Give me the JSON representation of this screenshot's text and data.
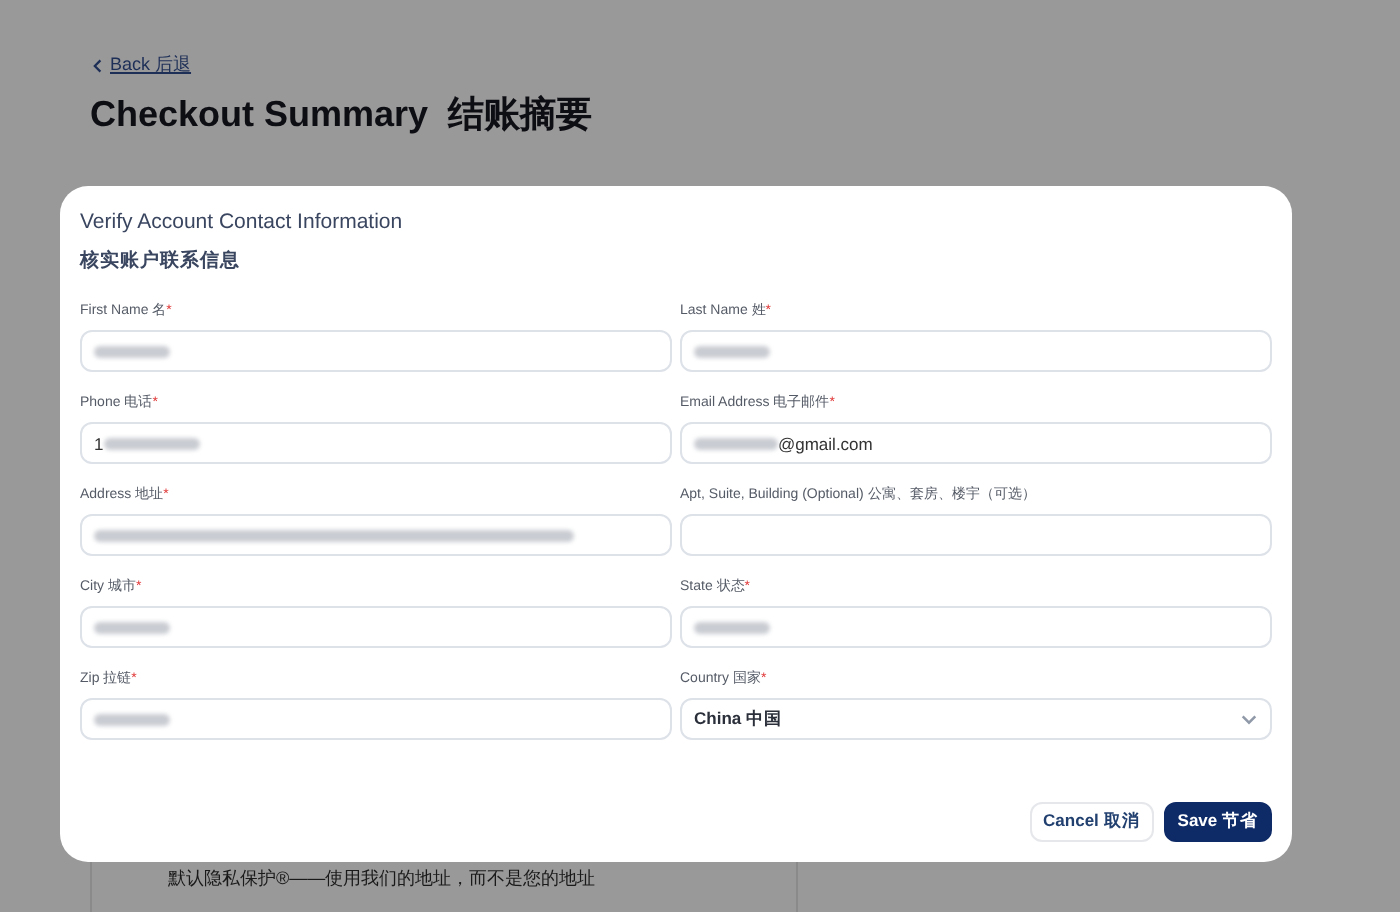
{
  "page": {
    "back_link": "Back 后退",
    "title": "Checkout Summary  结账摘要",
    "notice": "默认隐私保护®——使用我们的地址，而不是您的地址"
  },
  "dialog": {
    "title": "Verify Account Contact Information",
    "subtitle": "核实账户联系信息",
    "fields": [
      {
        "label": "First Name 名",
        "mark": "*",
        "kind": "masked"
      },
      {
        "label": "Last Name 姓",
        "mark": "*",
        "kind": "masked"
      },
      {
        "label": "Phone 电话",
        "mark": "*",
        "kind": "masked_tail",
        "value": "1"
      },
      {
        "label": "Email Address 电子邮件",
        "mark": "*",
        "kind": "masked_head",
        "value": "@gmail.com"
      },
      {
        "label": "Address 地址",
        "mark": "*",
        "kind": "masked_long"
      },
      {
        "label": "Apt, Suite, Building (Optional) 公寓、套房、楼宇（可选）",
        "kind": "text"
      },
      {
        "label": "City 城市",
        "mark": "*",
        "kind": "masked"
      },
      {
        "label": "State 状态",
        "mark": "*",
        "kind": "masked"
      },
      {
        "label": "Zip 拉链",
        "mark": "*",
        "kind": "masked"
      },
      {
        "label": "Country 国家",
        "mark": "*",
        "kind": "select",
        "value": "China  中国"
      }
    ],
    "buttons": [
      {
        "label": "Cancel 取消",
        "kind": "secondary"
      },
      {
        "label": "Save  节省",
        "kind": "primary"
      }
    ]
  }
}
